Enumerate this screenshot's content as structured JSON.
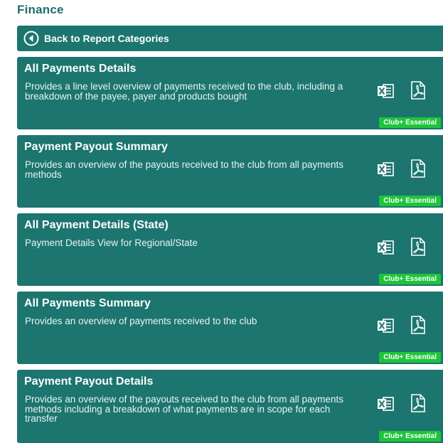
{
  "section": {
    "title": "Finance"
  },
  "back": {
    "label": "Back to Report Categories"
  },
  "reports": [
    {
      "title": "All Payments Details",
      "description": "Provides a line level overview of payments received to the club, including a breakdown of the payee, payer and products bought",
      "badge": "Club+ Essential"
    },
    {
      "title": "Payment Payout Summary",
      "description": "Provides an overview of the payouts received to the club from all payments methods",
      "badge": "Club+ Essential"
    },
    {
      "title": "All Payment Details (State)",
      "description": "Payment Details View for Regional/State",
      "badge": "Club+ Essential"
    },
    {
      "title": "All Payments Summary",
      "description": "Provides an overview of payments received to the club",
      "badge": "Club+ Essential"
    },
    {
      "title": "Payment Payout Details",
      "description": "Provides an overview of the payouts received to the club from all payments methods including a breakdown of what payments are in scope for each transfer",
      "badge": "Club+ Essential"
    }
  ],
  "colors": {
    "card_bg": "#1c756f",
    "title_text": "#1c6f6b",
    "badge_bg": "#1ec43a"
  },
  "icons": {
    "back": "circle-arrow-left-icon",
    "excel": "excel-icon",
    "pdf": "pdf-icon"
  }
}
